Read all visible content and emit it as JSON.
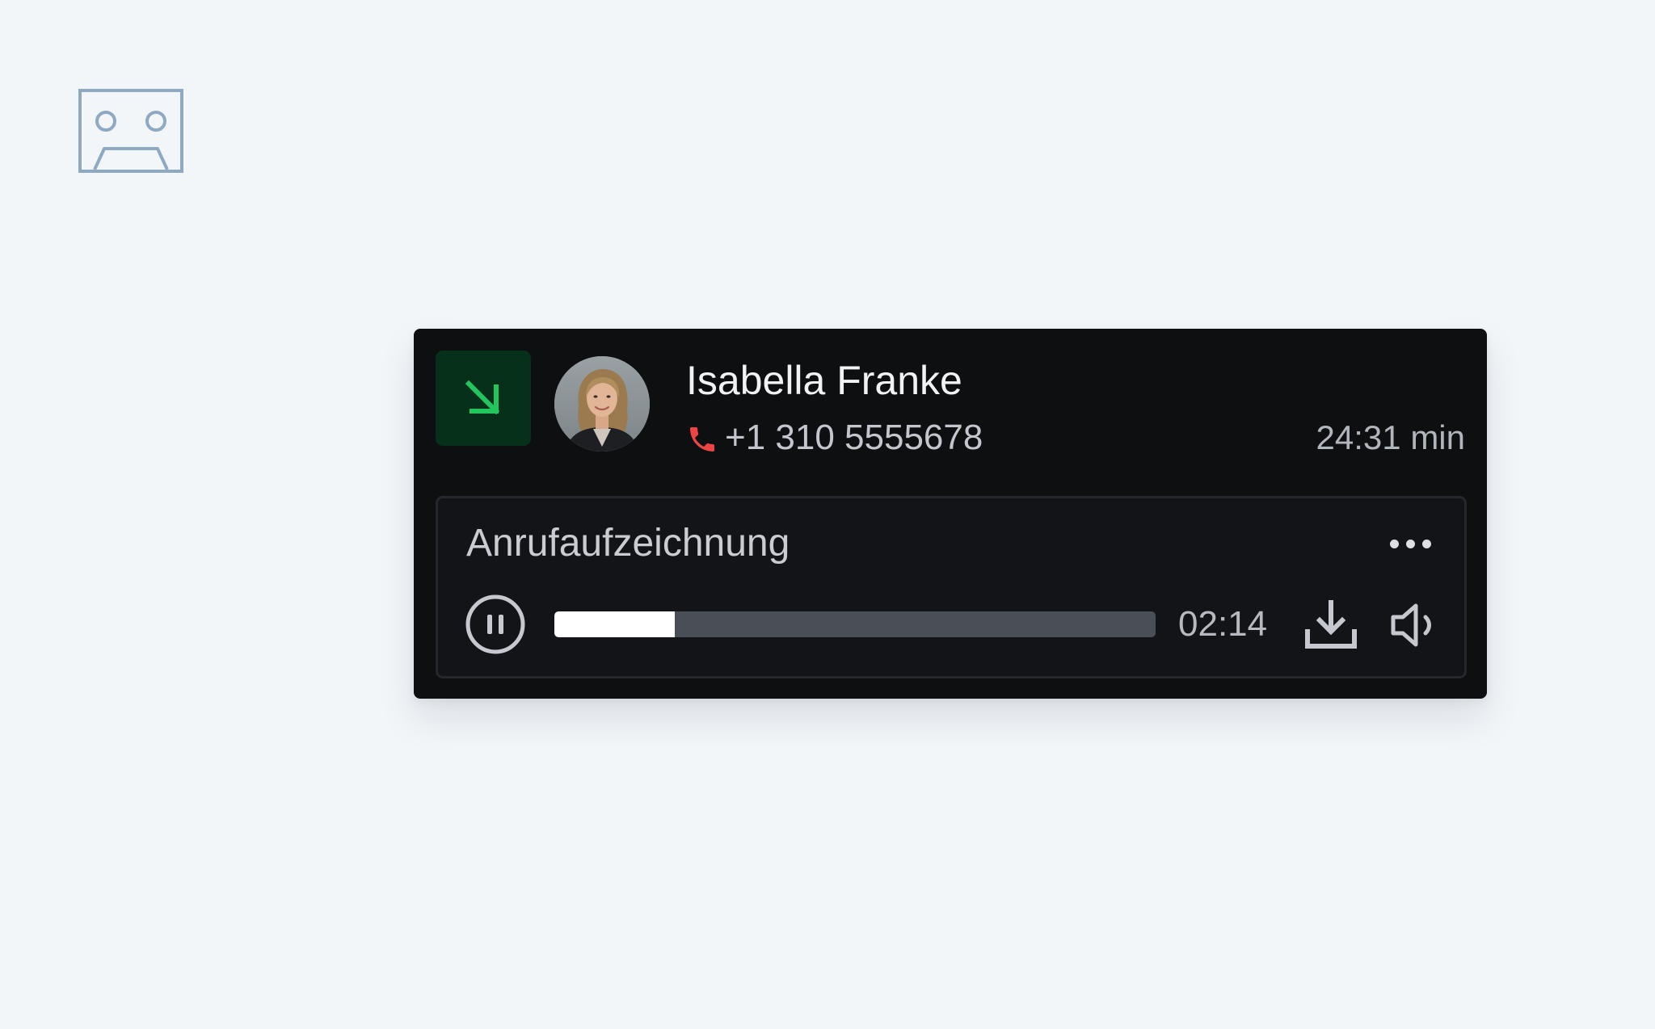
{
  "icons": {
    "placeholder": "cassette-tape-icon",
    "direction": "arrow-down-right-icon",
    "phone": "phone-icon",
    "more": "more-horizontal-icon",
    "pause": "pause-circle-icon",
    "download": "download-icon",
    "volume": "volume-icon"
  },
  "colors": {
    "page_background": "#f2f6f9",
    "card_background": "#0e0f11",
    "incoming_accent": "#22c55e",
    "incoming_badge_bg": "#06301a",
    "phone_icon": "#ef4444",
    "placeholder_icon": "#90a9c2"
  },
  "call": {
    "direction": "incoming",
    "contact_name": "Isabella Franke",
    "phone_number": "+1 310 5555678",
    "duration": "24:31 min"
  },
  "recording": {
    "title": "Anrufaufzeichnung",
    "current_time": "02:14",
    "progress": 0.2,
    "state": "playing"
  }
}
